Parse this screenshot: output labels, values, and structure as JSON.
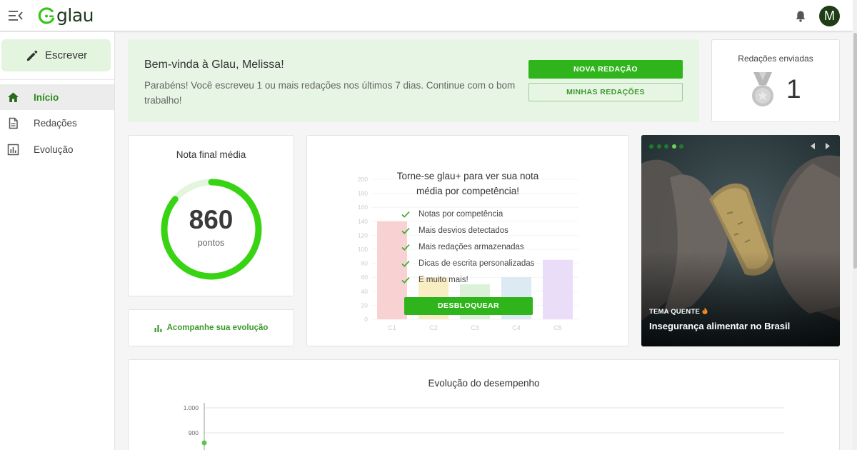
{
  "app": {
    "logo_text": "glau"
  },
  "header": {
    "avatar_initial": "M"
  },
  "sidebar": {
    "write_label": "Escrever",
    "items": [
      {
        "label": "Início",
        "active": true,
        "icon": "home-icon"
      },
      {
        "label": "Redações",
        "active": false,
        "icon": "document-icon"
      },
      {
        "label": "Evolução",
        "active": false,
        "icon": "bar-chart-icon"
      }
    ]
  },
  "welcome": {
    "title": "Bem-vinda à Glau, Melissa!",
    "text": "Parabéns! Você escreveu 1 ou mais redações nos últimos 7 dias. Continue com o bom trabalho!",
    "primary_button": "NOVA REDAÇÃO",
    "secondary_button": "MINHAS REDAÇÕES"
  },
  "sent": {
    "title": "Redações enviadas",
    "count": "1",
    "icon": "silver-medal-icon"
  },
  "nota": {
    "title": "Nota final média",
    "value": "860",
    "unit": "pontos",
    "max": 1000,
    "accent": "#38d414"
  },
  "evolution_link": {
    "label": "Acompanhe sua evolução"
  },
  "competency": {
    "title_line1": "Torne-se glau+ para ver sua nota",
    "title_line2": "média por competência!",
    "features": [
      "Notas por competência",
      "Mais desvios detectados",
      "Mais redações armazenadas",
      "Dicas de escrita personalizadas",
      "E muito mais!"
    ],
    "unlock_button": "DESBLOQUEAR"
  },
  "theme": {
    "tag": "TEMA QUENTE",
    "title": "Insegurança alimentar no Brasil",
    "slides": 5,
    "active_slide": 4
  },
  "performance": {
    "title": "Evolução do desempenho"
  },
  "chart_data": [
    {
      "type": "bar",
      "categories": [
        "C1",
        "C2",
        "C3",
        "C4",
        "C5"
      ],
      "values": [
        140,
        60,
        50,
        60,
        85
      ],
      "colors": [
        "#f6c4c4",
        "#f8e8b0",
        "#cfeecd",
        "#cfe4f0",
        "#e3d2f6"
      ],
      "ylim": [
        0,
        200
      ],
      "yticks": [
        "0",
        "20",
        "40",
        "60",
        "80",
        "100",
        "120",
        "140",
        "160",
        "180",
        "200"
      ]
    },
    {
      "type": "line",
      "title": "Evolução do desempenho",
      "yticks": [
        "1.000",
        "900"
      ],
      "ylim": [
        800,
        1000
      ],
      "series": [
        {
          "values": [
            860
          ]
        }
      ]
    }
  ]
}
